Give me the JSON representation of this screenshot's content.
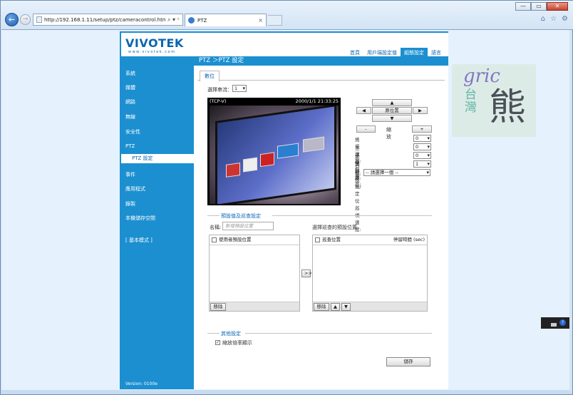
{
  "browser": {
    "url": "http://192.168.1.11/setup/ptz/cameracontrol.html",
    "addr_tools": [
      "⌕ ▾",
      "ᶜ"
    ],
    "tab_title": "PTZ",
    "tab_close": "×",
    "window_buttons": [
      "—",
      "▭",
      "✕"
    ],
    "back": "←",
    "forward": "→",
    "right_tools": [
      "⌂",
      "☆",
      "⚙"
    ]
  },
  "vivotek": {
    "logo": "VIVOTEK",
    "logo_sub": "www.vivotek.com",
    "top_menu": [
      "首頁",
      "用戶端設定值",
      "組態設定",
      "語言"
    ],
    "active_menu_index": 2,
    "page_title": "PTZ ＞PTZ 設定",
    "sidebar": [
      "系統",
      "媒體",
      "網路",
      "無線",
      "安全性",
      "PTZ",
      "事件",
      "應用程式",
      "錄製",
      "本機儲存空間",
      "[ 基本模式 ]"
    ],
    "sidebar_sub": "PTZ 設定",
    "version": "Version: 0100e",
    "subtab": "數位",
    "stream_label": "選擇串流：",
    "stream_value": "1",
    "video_mode": "(TCP-V)",
    "video_time": "2000/1/1 21:33:25",
    "ptz": {
      "up": "▲",
      "down": "▼",
      "left": "◀",
      "right": "▶",
      "home": "原位置",
      "zoom_out": "-",
      "zoom_in": "+",
      "zoom_label": "縮放",
      "speeds": [
        {
          "label": "搖攝速度:",
          "value": "0"
        },
        {
          "label": "上下傾斜速度:",
          "value": "0"
        },
        {
          "label": "變焦速度:",
          "value": "0"
        },
        {
          "label": "自動搖攝/定位巡視速度:",
          "value": "1"
        }
      ],
      "goto_label": "到:",
      "goto_value": "-- 請選擇一個 --"
    },
    "preset_section": "預設值及巡查設定",
    "name_label": "名稱:",
    "name_placeholder": "新增預設位置",
    "patrol_label": "選擇巡查的預設位置",
    "user_presets": "使用者預設位置",
    "patrol_position": "巡查位置",
    "dwell_time": "停留時間 (sec)",
    "remove": "移除",
    "transfer": ">>",
    "move_up": "▲",
    "move_down": "▼",
    "other_section": "其他設定",
    "zoom_ratio": "縮放倍率顯示",
    "zoom_ratio_checked": "✓",
    "save": "儲存"
  },
  "watermark": {
    "line1": "gric",
    "line2": "台灣",
    "line3": "熊"
  },
  "tray": {
    "help": "?"
  }
}
